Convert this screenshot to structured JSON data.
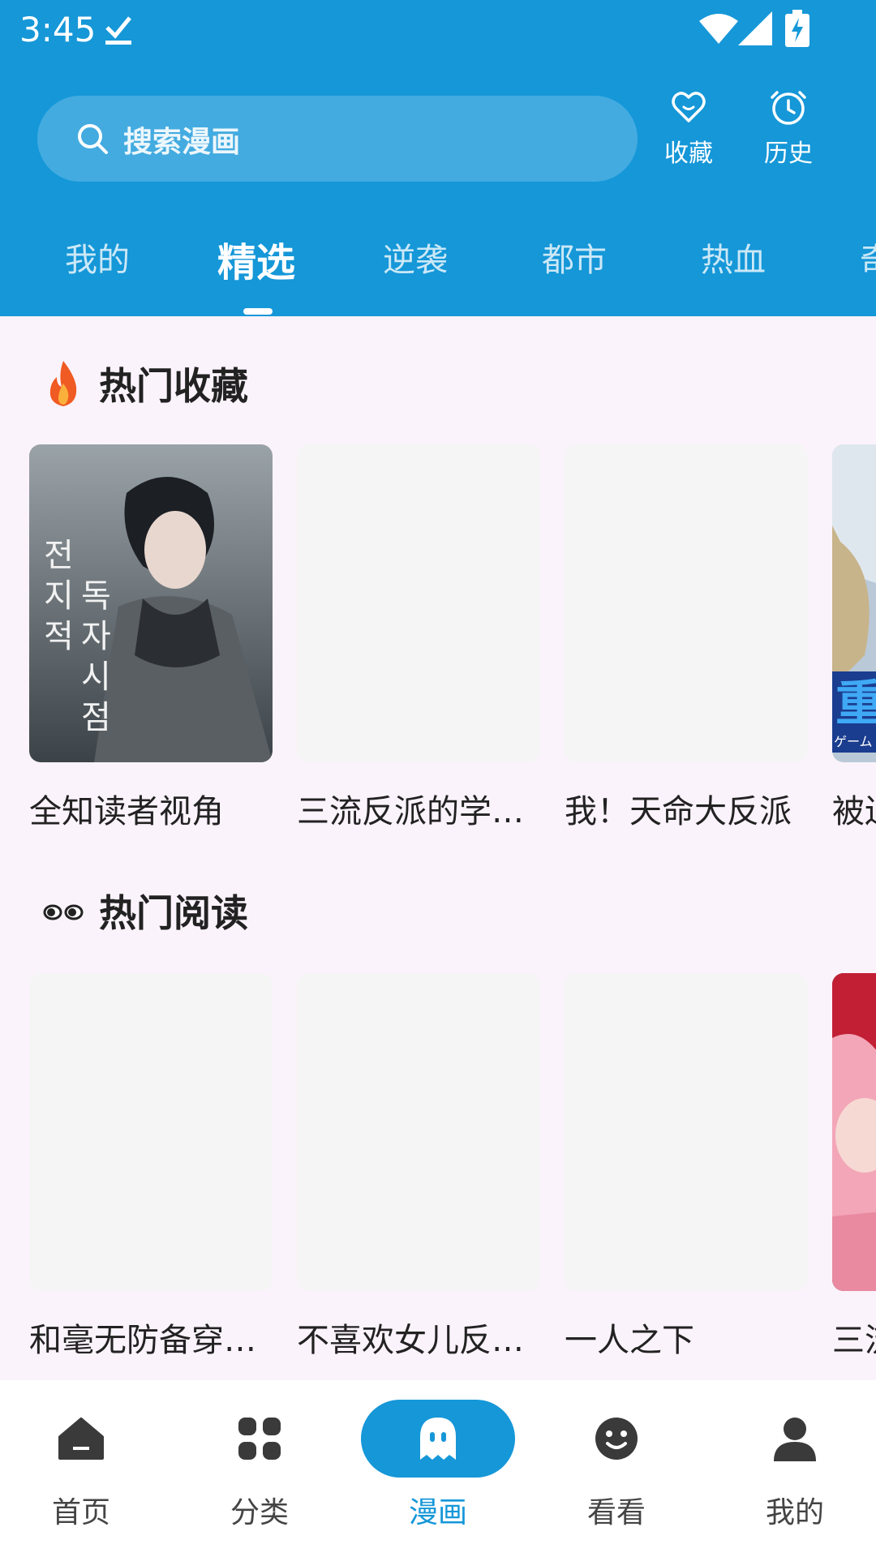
{
  "status_bar": {
    "time": "3:45"
  },
  "search": {
    "placeholder": "搜索漫画"
  },
  "top_actions": {
    "favorites_label": "收藏",
    "history_label": "历史"
  },
  "tabs": [
    {
      "label": "我的"
    },
    {
      "label": "精选"
    },
    {
      "label": "逆袭"
    },
    {
      "label": "都市"
    },
    {
      "label": "热血"
    },
    {
      "label": "奇"
    }
  ],
  "sections": [
    {
      "title": "热门收藏",
      "items": [
        {
          "title": "全知读者视角"
        },
        {
          "title": "三流反派的学…"
        },
        {
          "title": "我！天命大反派"
        },
        {
          "title": "被迫"
        }
      ]
    },
    {
      "title": "热门阅读",
      "items": [
        {
          "title": "和毫无防备穿…"
        },
        {
          "title": "不喜欢女儿反…"
        },
        {
          "title": "一人之下"
        },
        {
          "title": "三流"
        }
      ]
    }
  ],
  "cover_art": {
    "korean_title_vertical": [
      "전",
      "지",
      "적",
      "독",
      "자",
      "시",
      "점"
    ],
    "partial_cover_char": "重",
    "partial_cover_jp": "ゲーム"
  },
  "bottom_nav": [
    {
      "label": "首页",
      "icon": "home-icon"
    },
    {
      "label": "分类",
      "icon": "grid-icon"
    },
    {
      "label": "漫画",
      "icon": "ghost-icon"
    },
    {
      "label": "看看",
      "icon": "smile-icon"
    },
    {
      "label": "我的",
      "icon": "person-icon"
    }
  ],
  "colors": {
    "primary": "#1597d8",
    "background": "#fbf3fb",
    "placeholder_cover": "#f6f5f6"
  }
}
